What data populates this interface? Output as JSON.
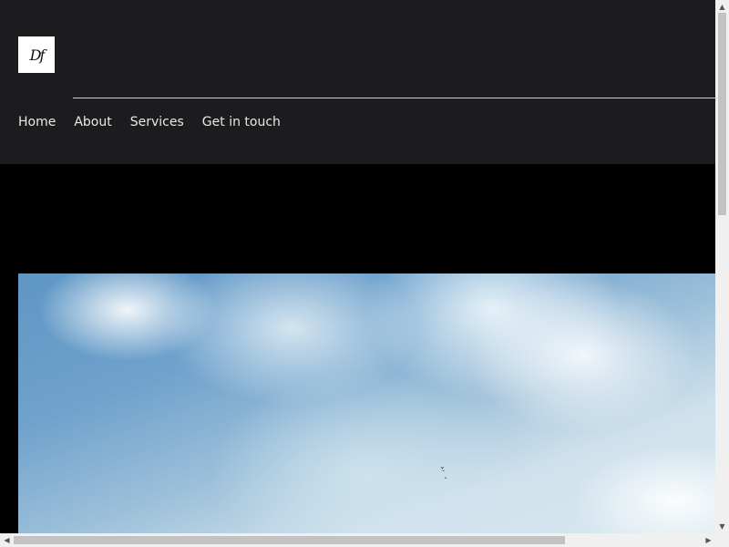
{
  "header": {
    "logo_text": "Df",
    "nav": [
      {
        "label": "Home"
      },
      {
        "label": "About"
      },
      {
        "label": "Services"
      },
      {
        "label": "Get in touch"
      }
    ]
  },
  "hero": {
    "image": "sky-with-clouds"
  },
  "colors": {
    "header_bg": "#1c1b1d",
    "page_bg": "#000000",
    "nav_text": "#e8e8e8"
  }
}
